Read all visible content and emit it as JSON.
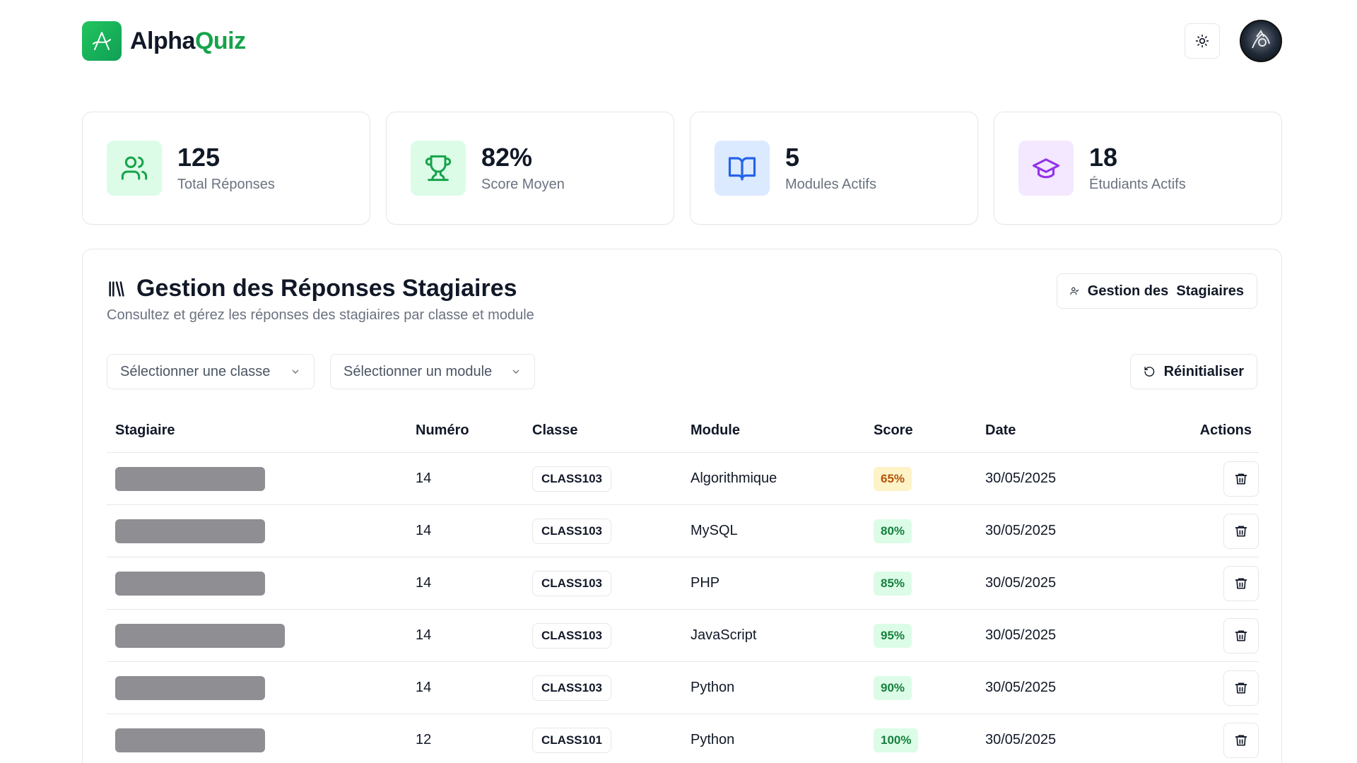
{
  "brand": {
    "prefix": "Alpha",
    "suffix": "Quiz"
  },
  "header": {
    "theme_icon": "sun-icon",
    "avatar_icon": "user-avatar"
  },
  "stats": [
    {
      "value": "125",
      "label": "Total Réponses",
      "icon": "users-icon",
      "bg": "#dcfce7",
      "color": "#16a34a"
    },
    {
      "value": "82%",
      "label": "Score Moyen",
      "icon": "trophy-icon",
      "bg": "#dcfce7",
      "color": "#16a34a"
    },
    {
      "value": "5",
      "label": "Modules Actifs",
      "icon": "book-open-icon",
      "bg": "#dbeafe",
      "color": "#2563eb"
    },
    {
      "value": "18",
      "label": "Étudiants Actifs",
      "icon": "graduation-cap-icon",
      "bg": "#f3e8ff",
      "color": "#9333ea"
    }
  ],
  "panel": {
    "title": "Gestion des Réponses Stagiaires",
    "subtitle": "Consultez et gérez les réponses des stagiaires par classe et module",
    "manage_button": "Gestion des  Stagiaires",
    "reset_button": "Réinitialiser",
    "select_class_placeholder": "Sélectionner une classe",
    "select_module_placeholder": "Sélectionner un module"
  },
  "table": {
    "headers": {
      "stagiaire": "Stagiaire",
      "numero": "Numéro",
      "classe": "Classe",
      "module": "Module",
      "score": "Score",
      "date": "Date",
      "actions": "Actions"
    },
    "rows": [
      {
        "numero": "14",
        "classe": "CLASS103",
        "module": "Algorithmique",
        "score": "65%",
        "score_level": "mid",
        "date": "30/05/2025",
        "name_redacted": true
      },
      {
        "numero": "14",
        "classe": "CLASS103",
        "module": "MySQL",
        "score": "80%",
        "score_level": "high",
        "date": "30/05/2025",
        "name_redacted": true
      },
      {
        "numero": "14",
        "classe": "CLASS103",
        "module": "PHP",
        "score": "85%",
        "score_level": "high",
        "date": "30/05/2025",
        "name_redacted": true
      },
      {
        "numero": "14",
        "classe": "CLASS103",
        "module": "JavaScript",
        "score": "95%",
        "score_level": "high",
        "date": "30/05/2025",
        "name_redacted": true
      },
      {
        "numero": "14",
        "classe": "CLASS103",
        "module": "Python",
        "score": "90%",
        "score_level": "high",
        "date": "30/05/2025",
        "name_redacted": true
      },
      {
        "numero": "12",
        "classe": "CLASS101",
        "module": "Python",
        "score": "100%",
        "score_level": "high",
        "date": "30/05/2025",
        "name_redacted": true
      }
    ]
  },
  "colors": {
    "accent": "#16a34a",
    "border": "#e5e7eb",
    "muted": "#6b7280"
  }
}
